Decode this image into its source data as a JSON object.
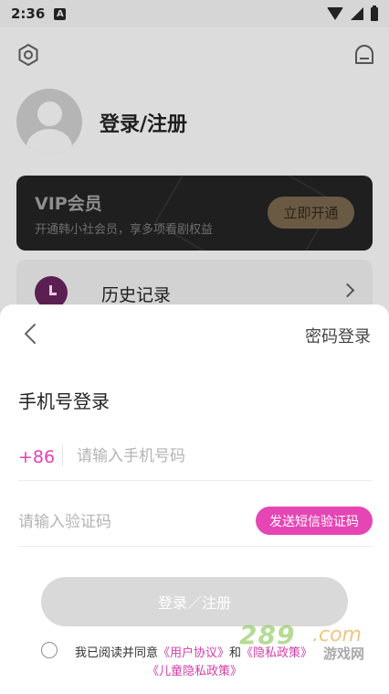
{
  "status_bar": {
    "time": "2:36",
    "notification_icon": "A"
  },
  "profile": {
    "title": "登录/注册",
    "vip": {
      "title": "VIP会员",
      "subtitle": "开通韩小社会员，享多项看剧权益",
      "button": "立即开通"
    },
    "history": {
      "label": "历史记录"
    }
  },
  "login_sheet": {
    "password_login": "密码登录",
    "title": "手机号登录",
    "country_code": "+86",
    "phone_placeholder": "请输入手机号码",
    "code_placeholder": "请输入验证码",
    "send_code": "发送短信验证码",
    "submit": "登录／注册",
    "agreement": {
      "prefix": "我已阅读并同意",
      "user_agreement": "《用户协议》",
      "and": "和",
      "privacy_policy": "《隐私政策》",
      "children_policy": "《儿童隐私政策》"
    }
  },
  "watermark": {
    "number": "289",
    "domain": ".com",
    "text": "游戏网"
  },
  "colors": {
    "accent": "#e645b4",
    "link": "#d33ea8",
    "button_disabled": "#d9d9d9"
  }
}
